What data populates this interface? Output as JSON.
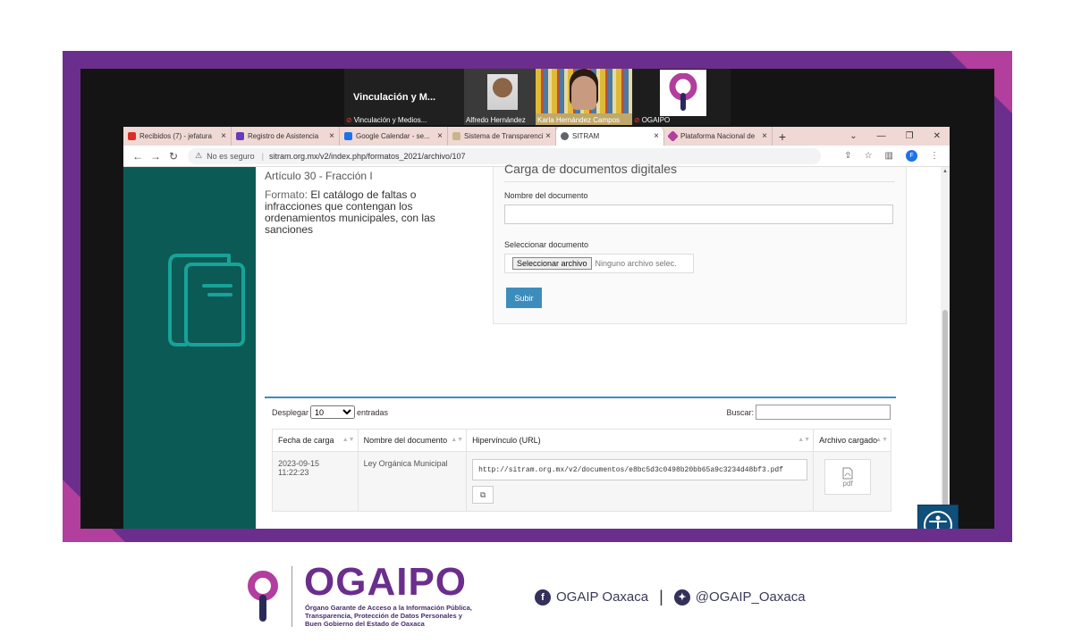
{
  "video": {
    "tile1_title": "Vinculación y M...",
    "tile1_caption": "Vinculación y Medios...",
    "tile2_caption": "Alfredo Hernández",
    "tile3_caption": "Karla Hernández Campos",
    "tile4_caption": "OGAIPO"
  },
  "browser": {
    "tabs": [
      {
        "label": "Recibidos (7) - jefatura",
        "icon": "gmail-icon",
        "color": "#d93025"
      },
      {
        "label": "Registro de Asistencia",
        "icon": "forms-icon",
        "color": "#673ab7"
      },
      {
        "label": "Google Calendar - se...",
        "icon": "calendar-icon",
        "color": "#1a73e8"
      },
      {
        "label": "Sistema de Transparencia",
        "icon": "site-icon",
        "color": "#c8b68a"
      },
      {
        "label": "SITRAM",
        "icon": "globe-icon",
        "color": "#5f6368"
      },
      {
        "label": "Plataforma Nacional de",
        "icon": "pnt-icon",
        "color": "#b23e9e"
      }
    ],
    "security_label": "No es seguro",
    "url": "sitram.org.mx/v2/index.php/formatos_2021/archivo/107",
    "profile_initial": "F"
  },
  "page": {
    "articulo": "Artículo 30 - Fracción I",
    "formato_label": "Formato:",
    "formato_text": "El catálogo de faltas o infracciones que contengan los ordenamientos municipales, con las sanciones",
    "carga_title": "Carga de documentos digitales",
    "nombre_label": "Nombre del documento",
    "nombre_value": "",
    "seleccionar_label": "Seleccionar documento",
    "file_button": "Seleccionar archivo",
    "file_status": "Ninguno archivo selec.",
    "subir": "Subir"
  },
  "table": {
    "show_prefix": "Desplegar",
    "page_size": "10",
    "show_suffix": "entradas",
    "search_label": "Buscar:",
    "search_value": "",
    "columns": [
      "Fecha de carga",
      "Nombre del documento",
      "Hipervínculo (URL)",
      "Archivo cargado"
    ],
    "rows": [
      {
        "fecha": "2023-09-15 11:22:23",
        "nombre": "Ley Orgánica Municipal",
        "url": "http://sitram.org.mx/v2/documentos/e8bc5d3c0498b20bb65a9c3234d48bf3.pdf",
        "archivo": "pdf"
      }
    ]
  },
  "footer": {
    "brand": "OGAIPO",
    "tagline_1": "Órgano Garante de Acceso a la Información Pública,",
    "tagline_2": "Transparencia, Protección de Datos Personales y",
    "tagline_3": "Buen Gobierno del Estado de Oaxaca",
    "facebook": "OGAIP Oaxaca",
    "twitter": "@OGAIP_Oaxaca"
  },
  "colors": {
    "frame": "#6b2e8c",
    "frame_accent": "#b23e9e",
    "sidebar": "#0b5a56",
    "teal_icon": "#17a398",
    "button": "#3c8dbc"
  }
}
